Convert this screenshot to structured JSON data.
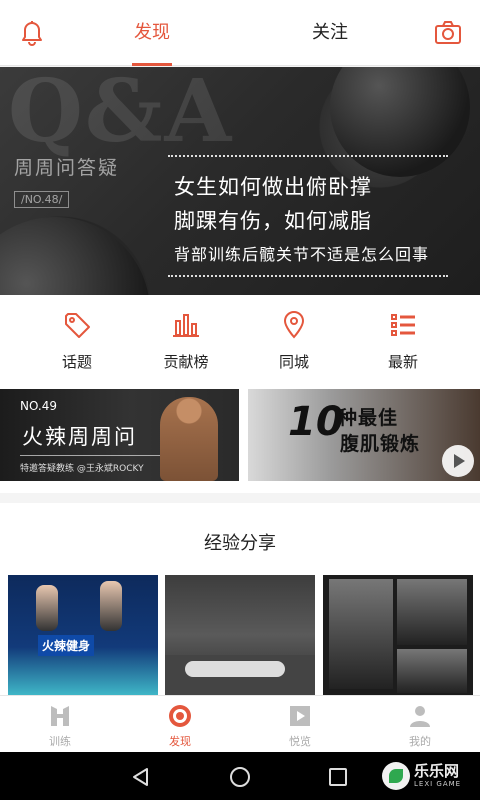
{
  "header": {
    "tabs": [
      {
        "label": "发现",
        "active": true
      },
      {
        "label": "关注",
        "active": false
      }
    ],
    "left_icon": "bell-icon",
    "right_icon": "camera-icon",
    "accent": "#e4573d"
  },
  "banner": {
    "watermark": "Q&A",
    "series": "周周问答疑",
    "issue": "/NO.48/",
    "lines": [
      "女生如何做出俯卧撑",
      "脚踝有伤，如何减脂",
      "背部训练后髋关节不适是怎么回事"
    ]
  },
  "categories": [
    {
      "label": "话题",
      "icon": "tag-icon"
    },
    {
      "label": "贡献榜",
      "icon": "bar-chart-icon"
    },
    {
      "label": "同城",
      "icon": "location-pin-icon"
    },
    {
      "label": "最新",
      "icon": "list-icon"
    }
  ],
  "promos": {
    "left": {
      "number": "NO.49",
      "title": "火辣周周问",
      "subtitle": "特邀答疑教练  @王永斌ROCKY"
    },
    "right": {
      "number": "10",
      "line1": "种最佳",
      "line2": "腹肌锻炼",
      "icon": "play-icon"
    }
  },
  "section": {
    "title": "经验分享",
    "thumb_tag": "火辣健身"
  },
  "bottom_nav": [
    {
      "label": "训练",
      "icon": "h-logo-icon",
      "active": false
    },
    {
      "label": "发现",
      "icon": "target-icon",
      "active": true
    },
    {
      "label": "悦览",
      "icon": "video-play-icon",
      "active": false
    },
    {
      "label": "我的",
      "icon": "person-icon",
      "active": false
    }
  ],
  "system_bar": {
    "watermark_name": "乐乐网",
    "watermark_en": "LEXI GAME"
  }
}
